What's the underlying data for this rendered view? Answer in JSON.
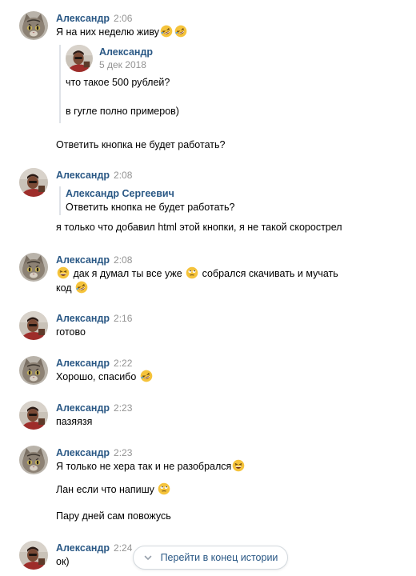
{
  "colors": {
    "link": "#2a5885",
    "time": "#939393",
    "quote_bar": "#dfe3e8"
  },
  "messages": [
    {
      "author": "Александр",
      "time": "2:06",
      "avatar": "cat-avatar",
      "text": "Я на них неделю живу",
      "forward": {
        "author": "Александр",
        "date": "5 дек 2018",
        "avatar": "person-avatar",
        "lines": [
          "что такое 500 рублей?",
          "в гугле полно примеров)"
        ]
      },
      "after": "Ответить кнопка не будет работать?"
    },
    {
      "author": "Александр",
      "time": "2:08",
      "avatar": "person-avatar",
      "reply": {
        "author": "Александр Сергеевич",
        "text": "Ответить кнопка не будет работать?"
      },
      "text": "я только что добавил html этой кнопки, я не такой скорострел"
    },
    {
      "author": "Александр",
      "time": "2:08",
      "avatar": "cat-avatar",
      "line1": "дак я думал ты все уже",
      "line1b": "собрался скачивать и мучать",
      "line2": "код"
    },
    {
      "author": "Александр",
      "time": "2:16",
      "avatar": "person-avatar",
      "text": "готово"
    },
    {
      "author": "Александр",
      "time": "2:22",
      "avatar": "cat-avatar",
      "text": "Хорошо, спасибо"
    },
    {
      "author": "Александр",
      "time": "2:23",
      "avatar": "person-avatar",
      "text": "пазяязя"
    },
    {
      "author": "Александр",
      "time": "2:23",
      "avatar": "cat-avatar",
      "line1": "Я только не хера так и не разобрался",
      "line2": "Лан если что напишу",
      "line3": "Пару дней сам повожусь"
    },
    {
      "author": "Александр",
      "time": "2:24",
      "avatar": "person-avatar",
      "text": "ок)"
    }
  ],
  "jump_button": {
    "label": "Перейти в конец истории",
    "icon": "chevron-down-icon"
  }
}
